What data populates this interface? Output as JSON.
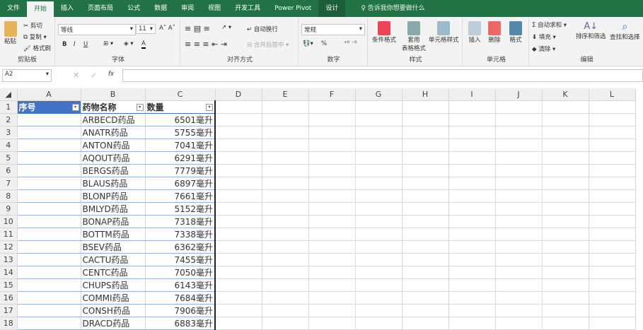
{
  "tabs": [
    "文件",
    "开始",
    "插入",
    "页面布局",
    "公式",
    "数据",
    "审阅",
    "视图",
    "开发工具",
    "Power Pivot",
    "设计"
  ],
  "tell_me": "告诉我你想要做什么",
  "ribbon": {
    "clipboard": {
      "paste": "粘贴",
      "cut": "剪切",
      "copy": "复制",
      "format_painter": "格式刷",
      "label": "剪贴板"
    },
    "font": {
      "name": "等线",
      "size": "11",
      "bold": "B",
      "italic": "I",
      "underline": "U",
      "label": "字体"
    },
    "align": {
      "wrap": "自动换行",
      "merge": "合并后居中",
      "label": "对齐方式"
    },
    "number": {
      "format": "常规",
      "percent": "%",
      "label": "数字"
    },
    "styles": {
      "cond": "条件格式",
      "table1": "套用",
      "table2": "表格格式",
      "cell": "单元格样式",
      "label": "样式"
    },
    "cells": {
      "insert": "插入",
      "delete": "删除",
      "format": "格式",
      "label": "单元格"
    },
    "editing": {
      "autosum": "自动求和",
      "fill": "填充",
      "clear": "清除",
      "sort": "排序和筛选",
      "find": "查找和选择",
      "label": "编辑"
    }
  },
  "formula": {
    "name_box": "A2",
    "fx": "fx",
    "value": ""
  },
  "columns": [
    "A",
    "B",
    "C",
    "D",
    "E",
    "F",
    "G",
    "H",
    "I",
    "J",
    "K",
    "L"
  ],
  "headers": [
    "序号",
    "药物名称",
    "数量"
  ],
  "rows": [
    [
      "ARBECD药品",
      "6501毫升"
    ],
    [
      "ANATR药品",
      "5755毫升"
    ],
    [
      "ANTON药品",
      "7041毫升"
    ],
    [
      "AQOUT药品",
      "6291毫升"
    ],
    [
      "BERGS药品",
      "7779毫升"
    ],
    [
      "BLAUS药品",
      "6897毫升"
    ],
    [
      "BLONP药品",
      "7661毫升"
    ],
    [
      "BMLYD药品",
      "5152毫升"
    ],
    [
      "BONAP药品",
      "7318毫升"
    ],
    [
      "BOTTM药品",
      "7338毫升"
    ],
    [
      "BSEV药品",
      "6362毫升"
    ],
    [
      "CACTU药品",
      "7455毫升"
    ],
    [
      "CENTC药品",
      "7050毫升"
    ],
    [
      "CHUPS药品",
      "6143毫升"
    ],
    [
      "COMMI药品",
      "7684毫升"
    ],
    [
      "CONSH药品",
      "7906毫升"
    ],
    [
      "DRACD药品",
      "6883毫升"
    ]
  ]
}
